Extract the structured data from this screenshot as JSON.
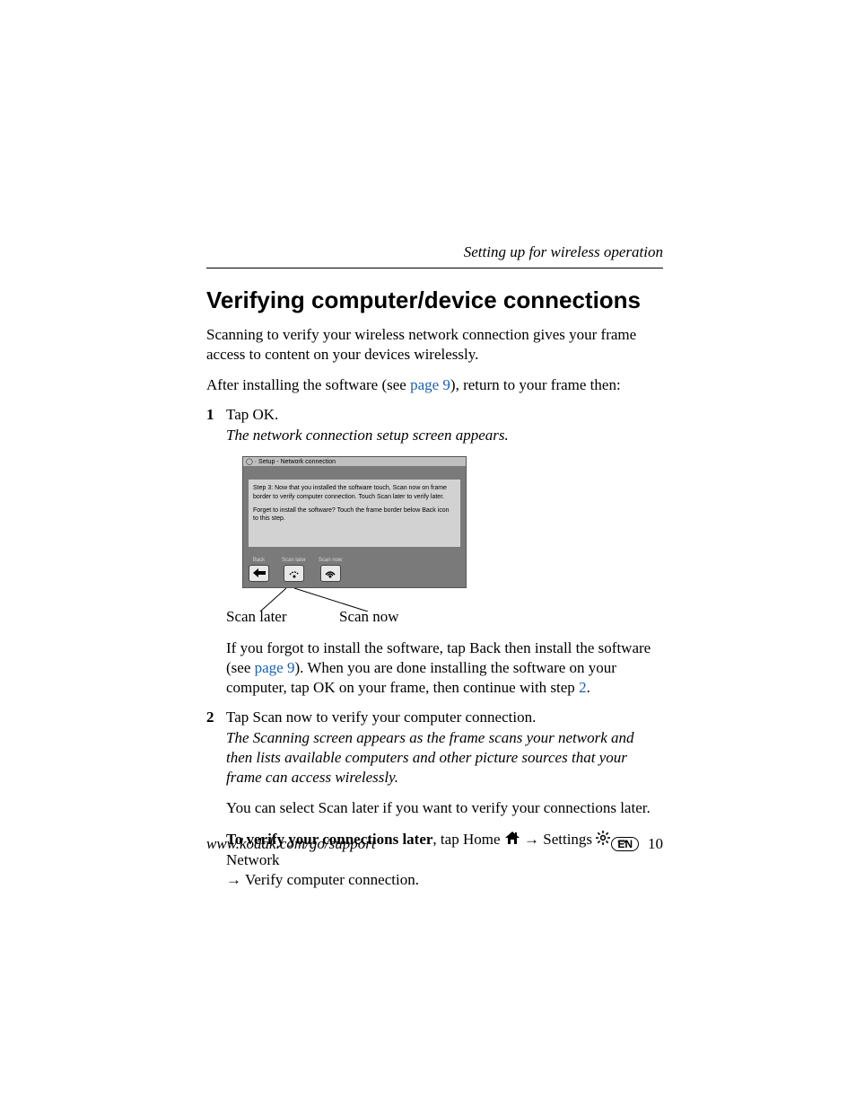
{
  "header": {
    "running_title": "Setting up for wireless operation"
  },
  "title": "Verifying computer/device connections",
  "intro": "Scanning to verify your wireless network connection gives your frame access to content on your devices wirelessly.",
  "after_install_pre": "After installing the software (see ",
  "after_install_link": "page 9",
  "after_install_post": "), return to your frame then:",
  "steps": {
    "s1": {
      "num": "1",
      "text": "Tap OK."
    },
    "s1_note": "The network connection setup screen appears.",
    "s2": {
      "num": "2",
      "text": "Tap Scan now to verify your computer connection."
    },
    "s2_note": "The Scanning screen appears as the frame scans your network and then lists available computers and other picture sources that your frame can access wirelessly.",
    "s2_after": "You can select Scan later if you want to verify your connections later."
  },
  "figure": {
    "titlebar": "◯ · Setup - Network connection",
    "line1": "Step 3: Now that you installed the software touch, Scan now on frame border to verify computer connection. Touch Scan later to verify later.",
    "line2": "Forget to install the software? Touch the frame border below Back icon to this step.",
    "buttons": {
      "back": "Back",
      "scan_later": "Scan later",
      "scan_now": "Scan now"
    },
    "callouts": {
      "left": "Scan later",
      "right": "Scan now"
    }
  },
  "forgot_pre": "If you forgot to install the software, tap Back then install the software (see ",
  "forgot_link": "page 9",
  "forgot_mid": "). When you are done installing the software on your computer, tap OK on your frame, then continue with step ",
  "forgot_step": "2",
  "forgot_post": ".",
  "verify_later": {
    "lead_bold": "To verify your connections later",
    "lead_rest": ", tap Home ",
    "arrow": "→",
    "settings": " Settings ",
    "network": " Network ",
    "tail": " Verify computer connection."
  },
  "footer": {
    "url": "www.kodak.com/go/support",
    "lang": "EN",
    "page": "10"
  }
}
